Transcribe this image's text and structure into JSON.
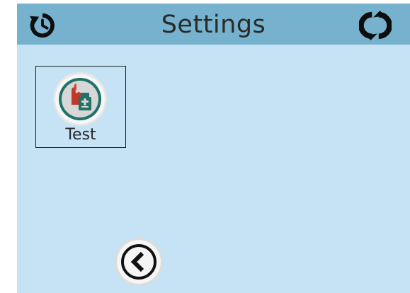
{
  "header": {
    "title": "Settings",
    "left_icon": "restart-icon",
    "right_icon": "refresh-icon"
  },
  "tiles": [
    {
      "label": "Test",
      "icon": "test-icon"
    }
  ],
  "footer": {
    "back_icon": "chevron-left-icon"
  },
  "colors": {
    "background": "#c5e3f5",
    "titlebar": "#76b1cd",
    "icon_ring": "#1e7268",
    "text": "#2a2a2a"
  }
}
